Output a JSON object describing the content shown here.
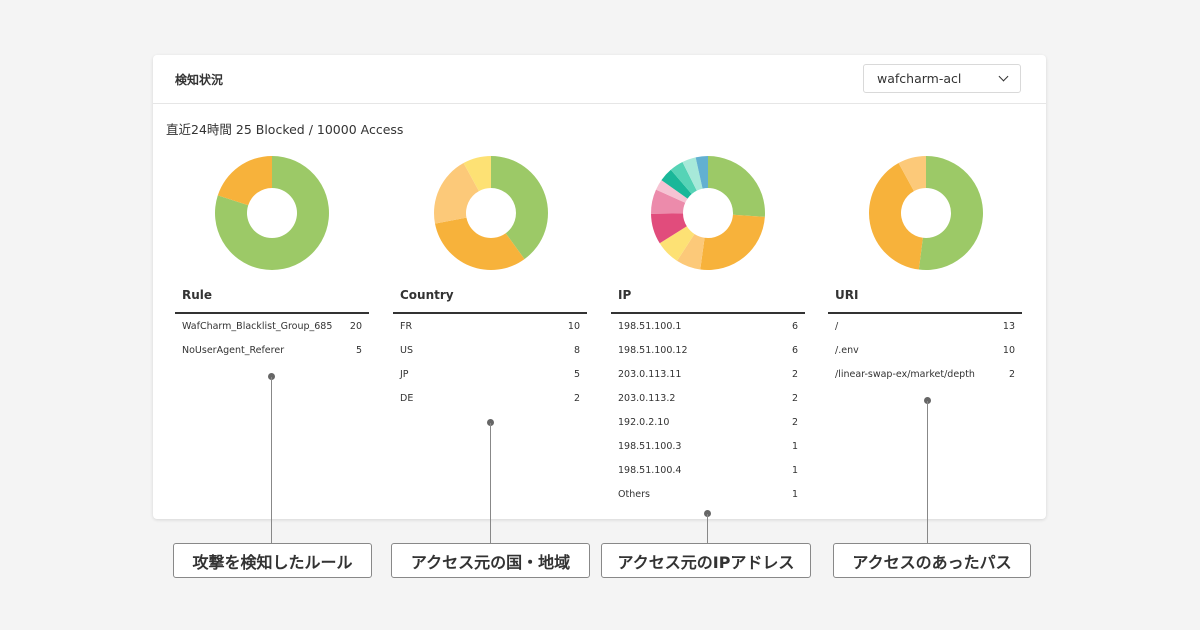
{
  "header": {
    "title": "検知状況",
    "acl_select": {
      "value": "wafcharm-acl"
    }
  },
  "summary": "直近24時間 25 Blocked / 10000 Access",
  "palette": {
    "green": "#9cc967",
    "orange": "#f7b23b",
    "peach": "#fcc979",
    "yellow": "#fde174",
    "pink": "#e14c7c",
    "rose": "#ec8bab",
    "lightpink": "#f6c3d3",
    "teal": "#1ab799",
    "aqua": "#56d3b6",
    "mint": "#a7e9d9",
    "blue": "#62b0d1"
  },
  "chart_data": [
    {
      "type": "pie",
      "variant": "donut",
      "header": "Rule",
      "categories": [
        "WafCharm_Blacklist_Group_685",
        "NoUserAgent_Referer"
      ],
      "values": [
        20,
        5
      ],
      "colors": [
        "#9cc967",
        "#f7b23b"
      ]
    },
    {
      "type": "pie",
      "variant": "donut",
      "header": "Country",
      "categories": [
        "FR",
        "US",
        "JP",
        "DE"
      ],
      "values": [
        10,
        8,
        5,
        2
      ],
      "colors": [
        "#9cc967",
        "#f7b23b",
        "#fcc979",
        "#fde174"
      ]
    },
    {
      "type": "pie",
      "variant": "donut",
      "header": "IP",
      "categories": [
        "198.51.100.1",
        "198.51.100.12",
        "203.0.113.11",
        "203.0.113.2",
        "192.0.2.10",
        "198.51.100.3",
        "198.51.100.4",
        "Others"
      ],
      "values": [
        6,
        6,
        2,
        2,
        2,
        1,
        1,
        1
      ],
      "slice_values": [
        6,
        6,
        1.6,
        1.6,
        2,
        1.6,
        0.7,
        0.9,
        0.9,
        0.9,
        0.8
      ],
      "colors": [
        "#9cc967",
        "#f7b23b",
        "#fcc979",
        "#fde174",
        "#e14c7c",
        "#ec8bab",
        "#f6c3d3",
        "#1ab799",
        "#56d3b6",
        "#a7e9d9",
        "#62b0d1"
      ]
    },
    {
      "type": "pie",
      "variant": "donut",
      "header": "URI",
      "categories": [
        "/",
        "/.env",
        "/linear-swap-ex/market/depth"
      ],
      "values": [
        13,
        10,
        2
      ],
      "colors": [
        "#9cc967",
        "#f7b23b",
        "#fcc979"
      ]
    }
  ],
  "callouts": [
    "攻撃を検知したルール",
    "アクセス元の国・地域",
    "アクセス元のIPアドレス",
    "アクセスのあったパス"
  ]
}
